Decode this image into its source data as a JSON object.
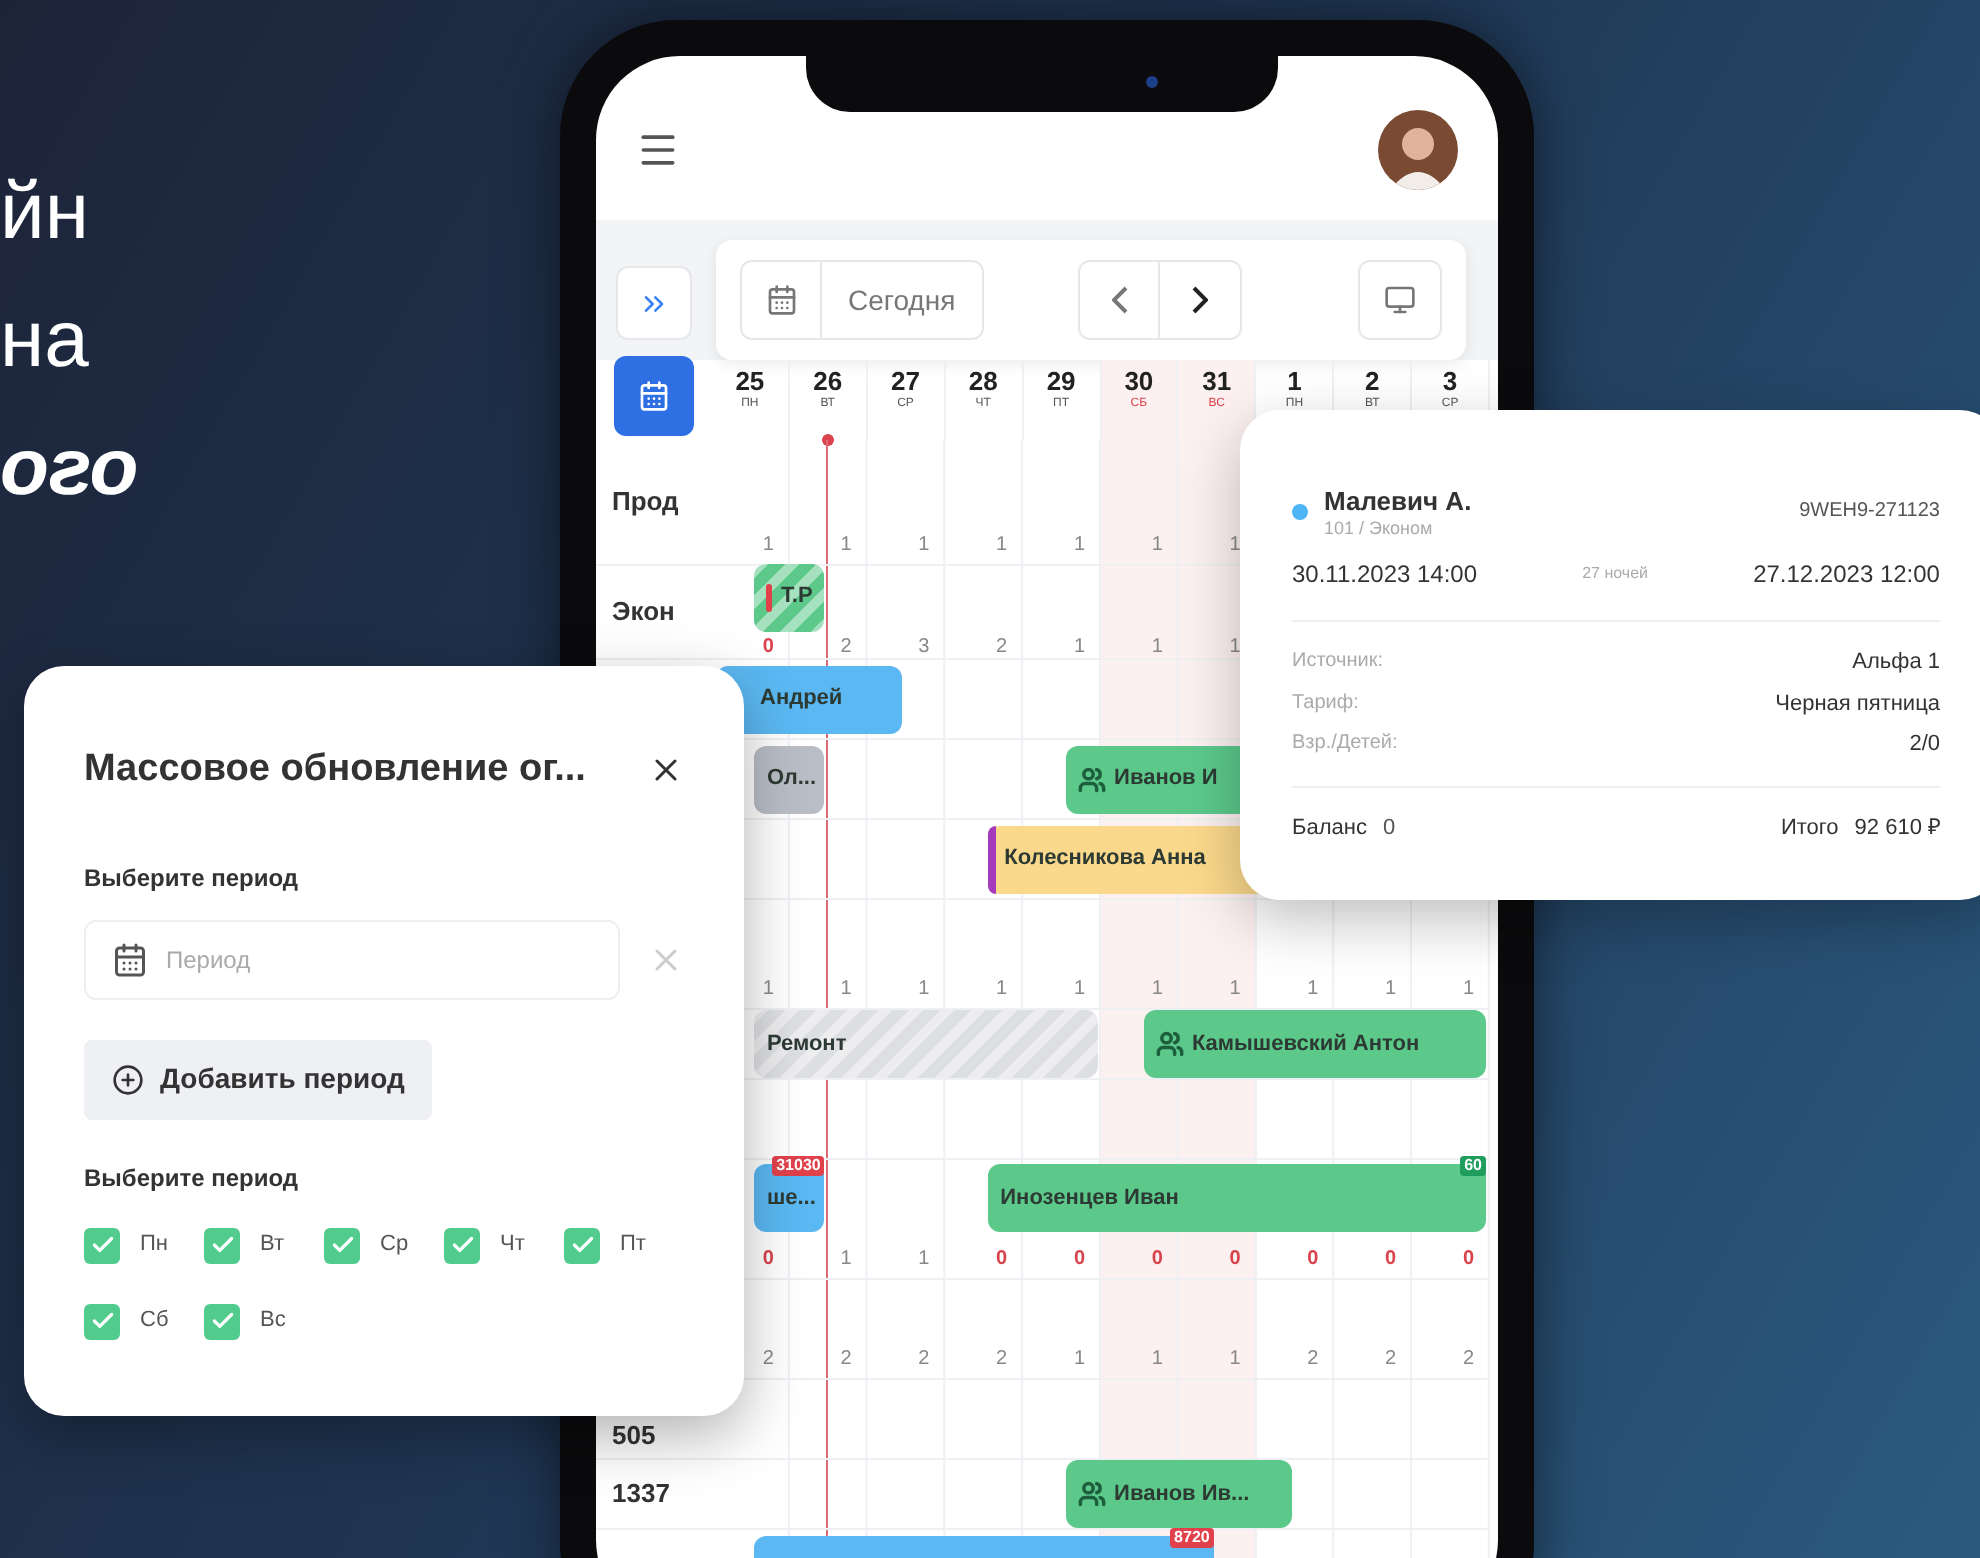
{
  "headline": [
    {
      "text": "йн",
      "italic": false
    },
    {
      "text": "на",
      "italic": false
    },
    {
      "text": "ого",
      "italic": true
    }
  ],
  "toolbar": {
    "today": "Сегодня"
  },
  "days": [
    {
      "date": "25",
      "weekday": "ПН",
      "weekend": false
    },
    {
      "date": "26",
      "weekday": "ВТ",
      "weekend": false,
      "today": true
    },
    {
      "date": "27",
      "weekday": "СР",
      "weekend": false
    },
    {
      "date": "28",
      "weekday": "ЧТ",
      "weekend": false
    },
    {
      "date": "29",
      "weekday": "ПТ",
      "weekend": false
    },
    {
      "date": "30",
      "weekday": "СБ",
      "weekend": true
    },
    {
      "date": "31",
      "weekday": "ВС",
      "weekend": true
    },
    {
      "date": "1",
      "weekday": "ПН",
      "weekend": false
    },
    {
      "date": "2",
      "weekday": "ВТ",
      "weekend": false
    },
    {
      "date": "3",
      "weekday": "СР",
      "weekend": false
    }
  ],
  "rows": [
    {
      "label": "Прод",
      "counts": [
        {
          "text": "1",
          "warn": false
        },
        {
          "text": "1",
          "warn": false
        },
        {
          "text": "1",
          "warn": false
        },
        {
          "text": "1",
          "warn": false
        },
        {
          "text": "1",
          "warn": false
        },
        {
          "text": "1",
          "warn": false
        },
        {
          "text": "1",
          "warn": false
        }
      ]
    },
    {
      "label": "Экон",
      "bookings": [
        {
          "name": "Т.Р",
          "color": "#5cc98b",
          "striped": true,
          "warn": true
        }
      ],
      "counts": [
        {
          "text": "0",
          "warn": true
        },
        {
          "text": "2",
          "warn": false
        },
        {
          "text": "3",
          "warn": false
        },
        {
          "text": "2",
          "warn": false
        },
        {
          "text": "1",
          "warn": false
        },
        {
          "text": "1",
          "warn": false
        },
        {
          "text": "1",
          "warn": false
        }
      ]
    },
    {
      "bookings": [
        {
          "name": "Андрей",
          "color": "#5bb8f2",
          "striped": false
        }
      ]
    },
    {
      "bookings": [
        {
          "name": "Ол...",
          "color": "#b9bdc6",
          "striped": false
        },
        {
          "name": "Иванов И",
          "color": "#5cc98b",
          "striped": false,
          "icon": true
        }
      ]
    },
    {
      "bookings": [
        {
          "name": "Колесникова Анна",
          "color": "#fbd98c",
          "accent": true,
          "striped": false
        }
      ]
    },
    {
      "counts": [
        {
          "text": "1",
          "warn": false
        },
        {
          "text": "1",
          "warn": false
        },
        {
          "text": "1",
          "warn": false
        },
        {
          "text": "1",
          "warn": false
        },
        {
          "text": "1",
          "warn": false
        },
        {
          "text": "1",
          "warn": false
        },
        {
          "text": "1",
          "warn": false
        },
        {
          "text": "1",
          "warn": false
        },
        {
          "text": "1",
          "warn": false
        },
        {
          "text": "1",
          "warn": false
        }
      ]
    },
    {
      "bookings": [
        {
          "name": "Ремонт",
          "color": "#dedfe2",
          "striped": true
        },
        {
          "name": "Камышевский Антон",
          "color": "#5cc98b",
          "striped": false,
          "icon": true
        }
      ]
    },
    {},
    {
      "bookings": [
        {
          "name": "ше...",
          "color": "#5bb8f2",
          "striped": false,
          "badge": {
            "text": "31030",
            "color": "#e0414b"
          }
        },
        {
          "name": "Инозенцев Иван",
          "color": "#5cc98b",
          "striped": false,
          "badge": {
            "text": "60",
            "color": "#1f9d5c"
          }
        }
      ],
      "counts": [
        {
          "text": "0",
          "warn": true
        },
        {
          "text": "1",
          "warn": false
        },
        {
          "text": "1",
          "warn": false
        },
        {
          "text": "0",
          "warn": true
        },
        {
          "text": "0",
          "warn": true
        },
        {
          "text": "0",
          "warn": true
        },
        {
          "text": "0",
          "warn": true
        },
        {
          "text": "0",
          "warn": true
        },
        {
          "text": "0",
          "warn": true
        },
        {
          "text": "0",
          "warn": true
        }
      ]
    },
    {
      "counts": [
        {
          "text": "2",
          "warn": false
        },
        {
          "text": "2",
          "warn": false
        },
        {
          "text": "2",
          "warn": false
        },
        {
          "text": "2",
          "warn": false
        },
        {
          "text": "1",
          "warn": false
        },
        {
          "text": "1",
          "warn": false
        },
        {
          "text": "1",
          "warn": false
        },
        {
          "text": "2",
          "warn": false
        },
        {
          "text": "2",
          "warn": false
        },
        {
          "text": "2",
          "warn": false
        }
      ]
    },
    {
      "label": "505"
    },
    {
      "label": "1337",
      "bookings": [
        {
          "name": "Иванов Ив...",
          "color": "#5cc98b",
          "striped": false,
          "icon": true
        }
      ]
    },
    {
      "bookings": [
        {
          "color": "#5bb8f2",
          "striped": false,
          "badge": {
            "text": "8720",
            "color": "#e0414b"
          }
        }
      ]
    }
  ],
  "modal": {
    "title": "Массовое обновление ог...",
    "period_label": "Выберите период",
    "period_placeholder": "Период",
    "add_button": "Добавить период",
    "days_label": "Выберите период",
    "days": [
      {
        "label": "Пн",
        "checked": true
      },
      {
        "label": "Вт",
        "checked": true
      },
      {
        "label": "Ср",
        "checked": true
      },
      {
        "label": "Чт",
        "checked": true
      },
      {
        "label": "Пт",
        "checked": true
      },
      {
        "label": "Сб",
        "checked": true
      },
      {
        "label": "Вс",
        "checked": true
      }
    ]
  },
  "booking_card": {
    "guest": "Малевич А.",
    "color": "#4db5f5",
    "room": "101 / Эконом",
    "code": "9WEH9-271123",
    "check_in": "30.11.2023 14:00",
    "nights": "27 ночей",
    "check_out": "27.12.2023 12:00",
    "details": [
      {
        "label": "Источник:",
        "value": "Альфа 1"
      },
      {
        "label": "Тариф:",
        "value": "Черная пятница"
      },
      {
        "label": "Взр./Детей:",
        "value": "2/0"
      }
    ],
    "balance_label": "Баланс",
    "balance": "0",
    "total_label": "Итого",
    "total": "92 610 ₽"
  }
}
